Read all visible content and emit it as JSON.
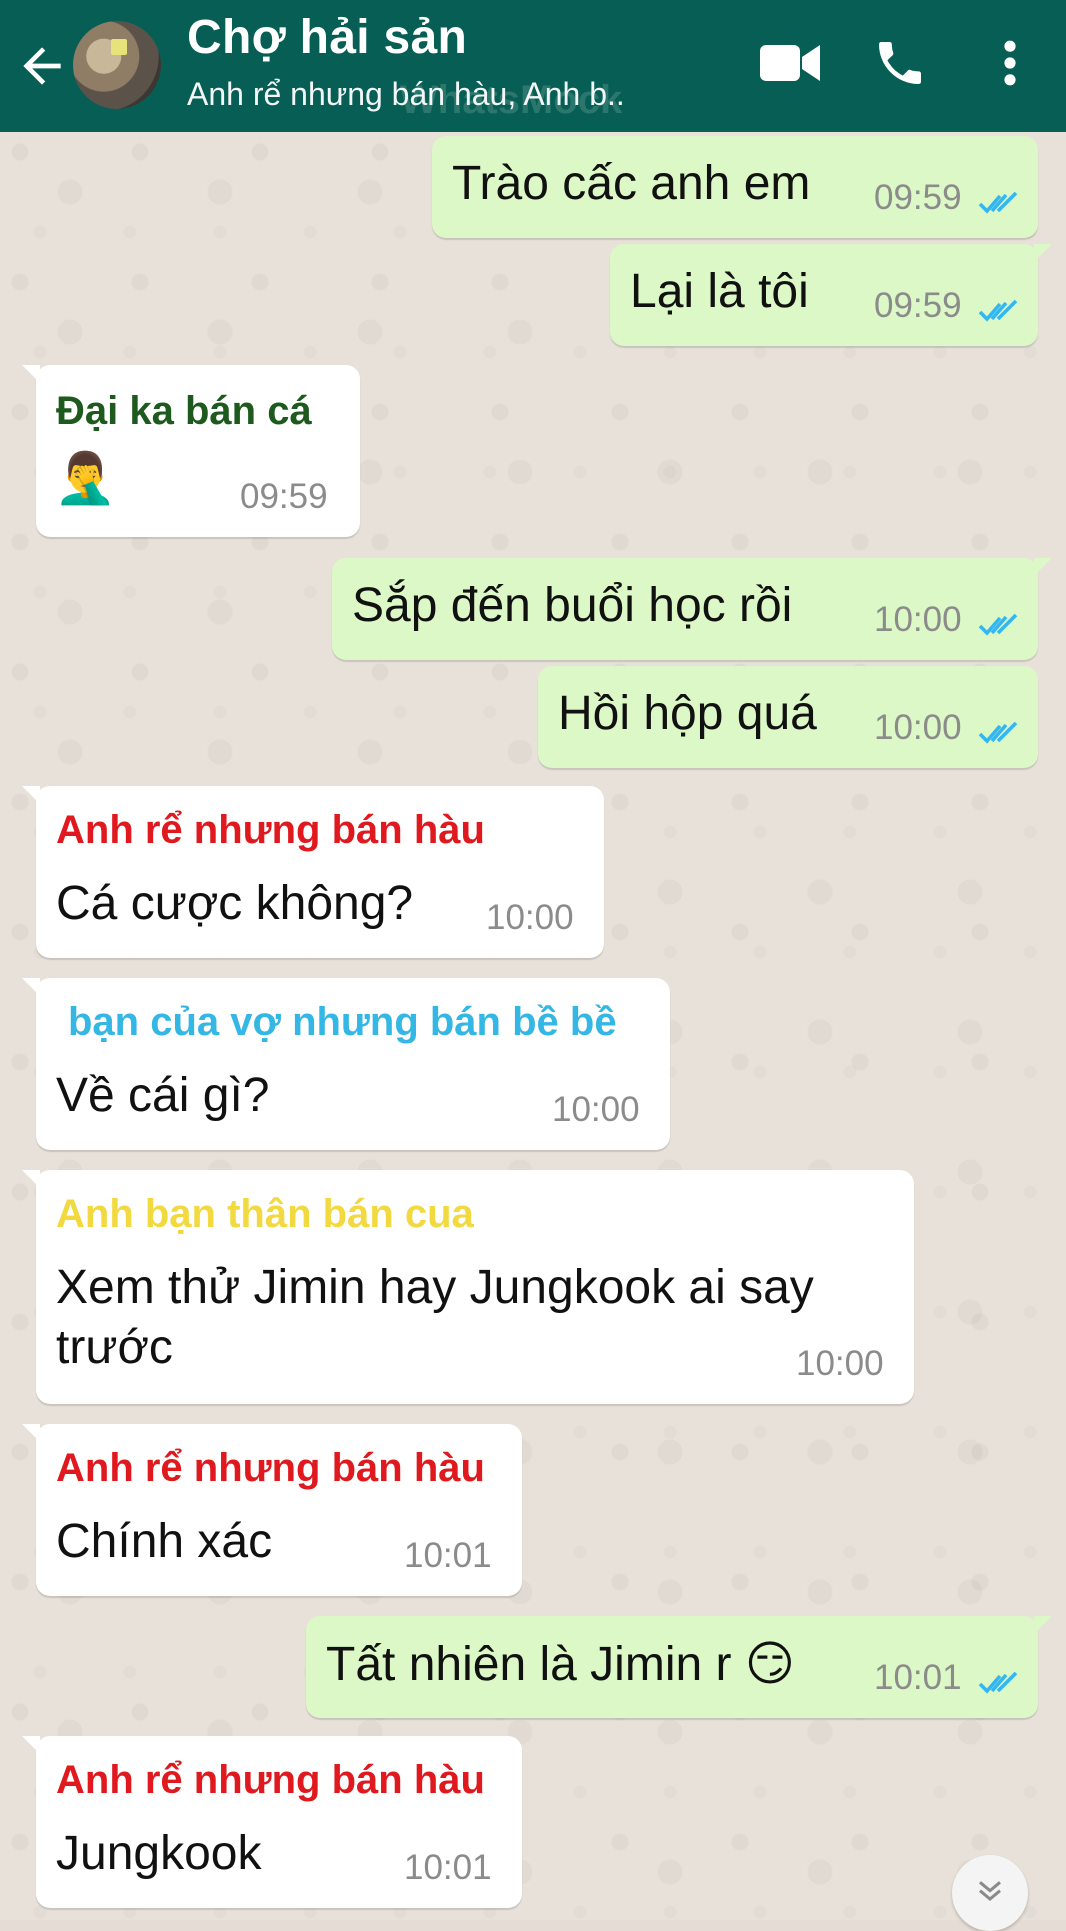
{
  "header": {
    "title": "Chợ hải sản",
    "subtitle": "Anh rể nhưng bán hàu, Anh b..",
    "watermark": "WhatsMock",
    "colors": {
      "bar": "#075e54",
      "icon": "#ffffff"
    },
    "icons": [
      "back-arrow-icon",
      "video-call-icon",
      "phone-icon",
      "more-vert-icon"
    ]
  },
  "colors": {
    "outgoing_bubble": "#dcf8c6",
    "incoming_bubble": "#ffffff",
    "read_ticks": "#34b7f1",
    "sender_green": "#1e5a1e",
    "sender_red": "#e0191f",
    "sender_cyan": "#34b7e5",
    "sender_yellow": "#f2d93f"
  },
  "messages": [
    {
      "dir": "out",
      "text": "Trào cấc anh em",
      "time": "09:59",
      "status": "read"
    },
    {
      "dir": "out",
      "text": "Lại là tôi",
      "time": "09:59",
      "status": "read"
    },
    {
      "dir": "in",
      "sender": "Đại ka bán cá",
      "text": "🤦‍♂️",
      "time": "09:59"
    },
    {
      "dir": "out",
      "text": "Sắp đến buổi học rồi",
      "time": "10:00",
      "status": "read"
    },
    {
      "dir": "out",
      "text": "Hồi hộp quá",
      "time": "10:00",
      "status": "read"
    },
    {
      "dir": "in",
      "sender": "Anh rể nhưng bán hàu",
      "text": "Cá cược không?",
      "time": "10:00"
    },
    {
      "dir": "in",
      "sender": "bạn của vợ nhưng bán bề bề",
      "text": "Về cái gì?",
      "time": "10:00"
    },
    {
      "dir": "in",
      "sender": "Anh bạn thân bán cua",
      "text_line1": "Xem thử Jimin hay Jungkook ai say",
      "text_line2": "trước",
      "time": "10:00"
    },
    {
      "dir": "in",
      "sender": "Anh rể nhưng bán hàu",
      "text": "Chính xác",
      "time": "10:01"
    },
    {
      "dir": "out",
      "text": "Tất nhiên là Jimin r 😏",
      "time": "10:01",
      "status": "read"
    },
    {
      "dir": "in",
      "sender": "Anh rể nhưng bán hàu",
      "text": "Jungkook",
      "time": "10:01"
    }
  ],
  "scroll_button": {
    "icon": "double-chevron-down-icon"
  }
}
